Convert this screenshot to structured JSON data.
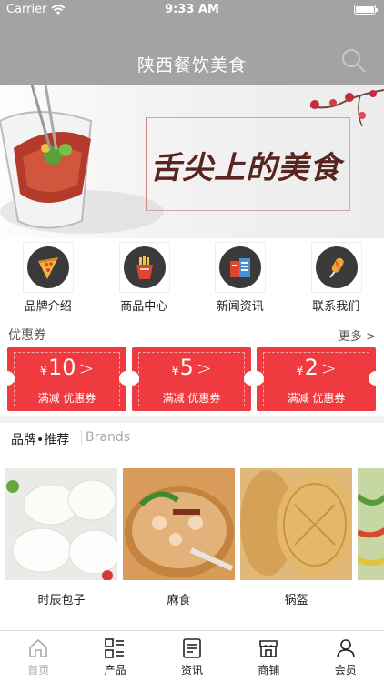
{
  "status_bar": {
    "carrier": "Carrier",
    "time": "9:33 AM"
  },
  "header": {
    "title": "陕西餐饮美食"
  },
  "banner": {
    "text": "舌尖上的美食"
  },
  "quick_menu": [
    {
      "label": "品牌介绍",
      "icon": "pizza-icon"
    },
    {
      "label": "商品中心",
      "icon": "fries-icon"
    },
    {
      "label": "新闻资讯",
      "icon": "news-icon"
    },
    {
      "label": "联系我们",
      "icon": "corndog-icon"
    }
  ],
  "coupons": {
    "title": "优惠券",
    "more": "更多 >",
    "items": [
      {
        "currency": "¥",
        "amount": "10",
        "arrow": ">",
        "desc": "满减 优惠券"
      },
      {
        "currency": "¥",
        "amount": "5",
        "arrow": ">",
        "desc": "满减 优惠券"
      },
      {
        "currency": "¥",
        "amount": "2",
        "arrow": ">",
        "desc": "满减 优惠券"
      }
    ],
    "accent": "#ef3b3f"
  },
  "brands": {
    "title": "品牌•推荐",
    "subtitle": "Brands",
    "items": [
      {
        "name": "时辰包子"
      },
      {
        "name": "麻食"
      },
      {
        "name": "锅盔"
      }
    ]
  },
  "tabbar": [
    {
      "label": "首页",
      "icon": "home-icon",
      "active": true
    },
    {
      "label": "产品",
      "icon": "grid-list-icon"
    },
    {
      "label": "资讯",
      "icon": "document-icon"
    },
    {
      "label": "商铺",
      "icon": "store-icon"
    },
    {
      "label": "会员",
      "icon": "user-icon"
    }
  ]
}
